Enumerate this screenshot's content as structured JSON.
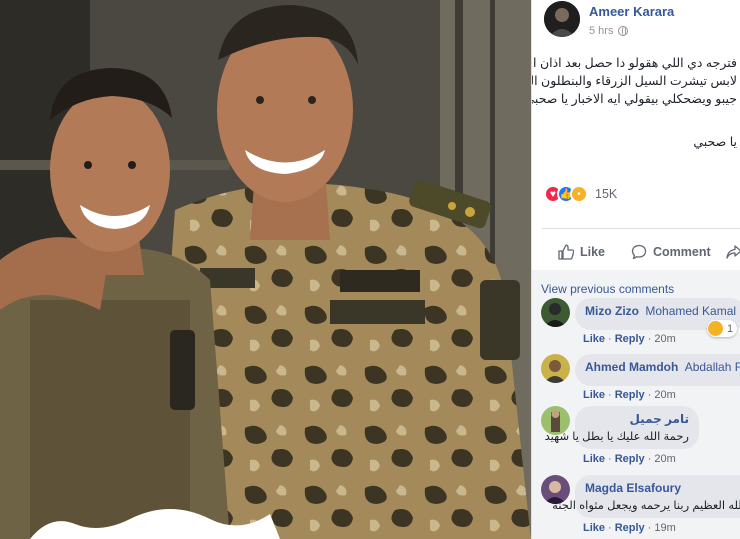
{
  "post": {
    "author": "Ameer Karara",
    "time": "5 hrs",
    "text_lines": [
      "فترجه دي اللي هقولو دا حصل بعد اذان الفجر",
      "لابس تيشرت السيل الزرقاء والبنطلون البيج",
      "جيبو ويضحكلي بيقولي ايه الاخبار يا صحبي"
    ],
    "text_trail": "يا صحبي",
    "reaction_count": "15K",
    "reaction_icons": [
      "love-icon",
      "like-icon",
      "wow-icon"
    ]
  },
  "actions": {
    "like": "Like",
    "comment": "Comment"
  },
  "comments_header": "View previous comments",
  "comments": [
    {
      "name": "Mizo Zizo",
      "tag": "Mohamed Kamal",
      "text": "",
      "like": "Like",
      "reply": "Reply",
      "time": "20m",
      "reaction": "1"
    },
    {
      "name": "Ahmed Mamdoh",
      "tag": "Abdallah Fa",
      "text": "",
      "like": "Like",
      "reply": "Reply",
      "time": "20m",
      "reaction": ""
    },
    {
      "name": "تامر جميل",
      "tag": "",
      "text": "رحمة الله عليك يا بطل يا شهيد",
      "like": "Like",
      "reply": "Reply",
      "time": "20m",
      "reaction": ""
    },
    {
      "name": "Magda Elsafoury",
      "tag": "",
      "text": "الله العظيم ربنا يرحمه ويجعل مثواه الجنة",
      "like": "Like",
      "reply": "Reply",
      "time": "19m",
      "reaction": ""
    }
  ],
  "photo_caption": "",
  "colors": {
    "link": "#385898",
    "muted": "#606770",
    "bubble": "#e4e6eb",
    "comments_bg": "#f2f3f5"
  }
}
